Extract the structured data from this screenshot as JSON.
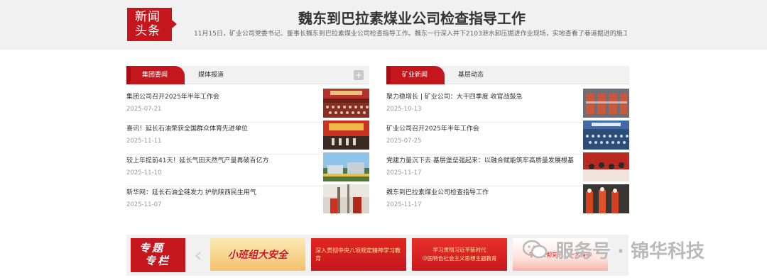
{
  "headline": {
    "badge_line1": "新闻",
    "badge_line2": "头条",
    "title": "魏东到巴拉素煤业公司检查指导工作",
    "summary": "11月15日，矿业公司党委书记、董事长魏东到巴拉素煤业公司检查指导工作。魏东一行深入井下2103泄水卸压掘进作业现场，实地查看了巷道掘进的施工..."
  },
  "left_panel": {
    "tab_active": "集团要闻",
    "tab_other": "媒体报道",
    "more": "+",
    "items": [
      {
        "title": "集团公司召开2025年半年工作会",
        "date": "2025-07-21"
      },
      {
        "title": "喜讯！延长石油荣获全国群众体育先进单位",
        "date": "2025-11-11"
      },
      {
        "title": "较上年提前41天！延长气田天然气产量再破百亿方",
        "date": "2025-11-10"
      },
      {
        "title": "新华网：延长石油全链发力 护航陕西民生用气",
        "date": "2025-11-07"
      }
    ]
  },
  "right_panel": {
    "tab_active": "矿业新闻",
    "tab_other": "基层动态",
    "items": [
      {
        "title": "聚力稳增长 | 矿业公司：大干四季度 收官战鼓急",
        "date": "2025-10-13"
      },
      {
        "title": "矿业公司召开2025年半年工作会",
        "date": "2025-07-25"
      },
      {
        "title": "党建力量沉下去 基层堡垒强起来：以融合赋能筑牢高质量发展根基",
        "date": "2025-11-17"
      },
      {
        "title": "魏东到巴拉素煤业公司检查指导工作",
        "date": "2025-11-17"
      }
    ]
  },
  "topics": {
    "logo_line1": "专题",
    "logo_line2": "专栏",
    "banners": [
      "小班组大安全",
      "深入贯彻中央八项规定精神学习教育",
      "学习贯彻习近平新时代",
      "中国特色社会主义思想主题教育",
      "学习贯彻党的二十大精神"
    ]
  },
  "watermark": {
    "text": "服务号 · 锦华科技"
  },
  "colors": {
    "brand_red": "#c4161c",
    "panel_gray": "#f1f1f1",
    "date_gray": "#999999"
  }
}
